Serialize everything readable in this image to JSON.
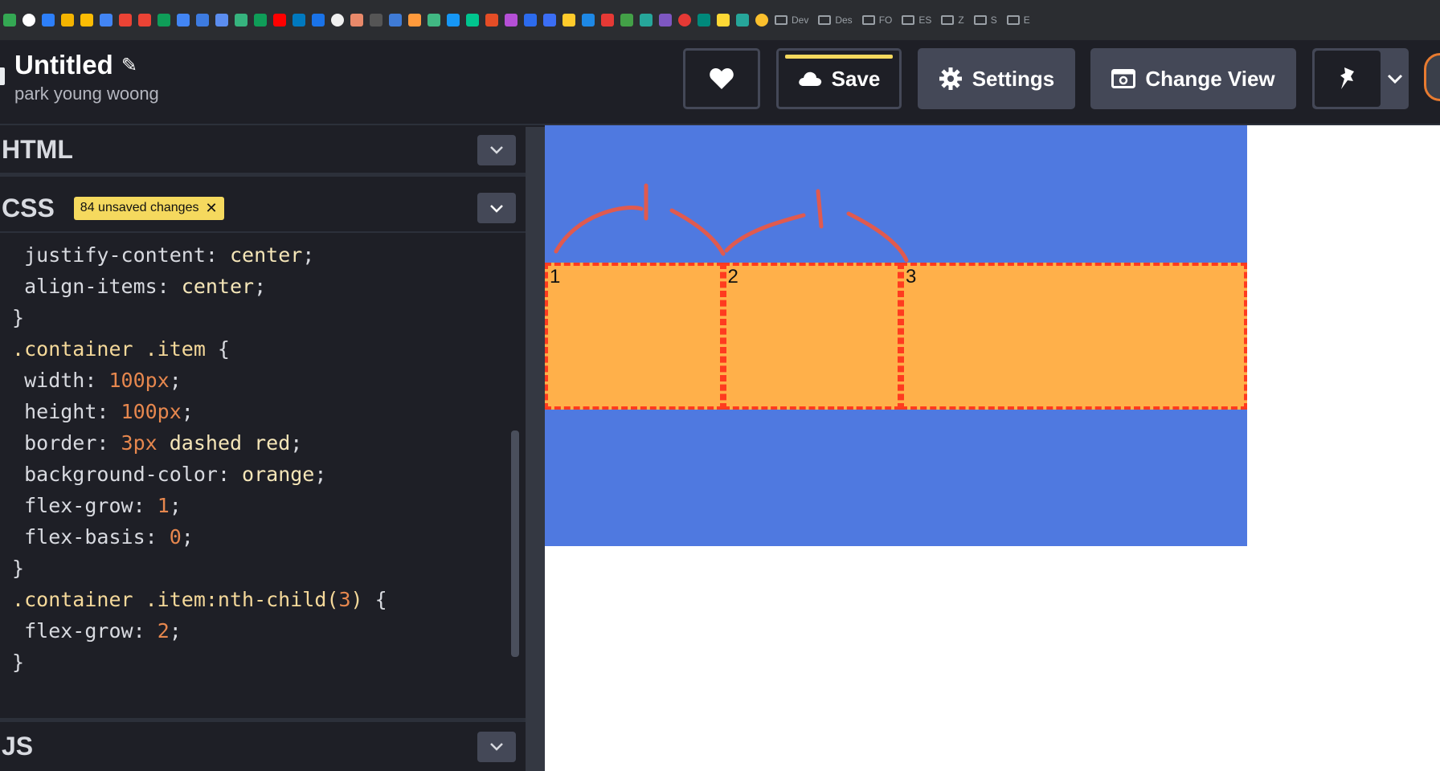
{
  "header": {
    "title": "Untitled",
    "author": "park young woong",
    "buttons": {
      "save": "Save",
      "settings": "Settings",
      "change_view": "Change View"
    }
  },
  "bookmarks": {
    "folders": [
      "Dev",
      "Des",
      "FO",
      "ES",
      "Z",
      "S",
      "E"
    ]
  },
  "editor": {
    "html_title": "HTML",
    "css_title": "CSS",
    "js_title": "JS",
    "unsaved_badge": "84 unsaved changes",
    "css_lines": [
      "  justify-content: center;",
      "  align-items: center;",
      "}",
      ".container .item {",
      "  width: 100px;",
      "  height: 100px;",
      "  border: 3px dashed red;",
      "  background-color: orange;",
      "  flex-grow: 1;",
      "  flex-basis: 0;",
      "}",
      ".container .item:nth-child(3) {",
      "  flex-grow: 2;",
      "}"
    ]
  },
  "preview": {
    "items": [
      {
        "label": "1",
        "grow": 1
      },
      {
        "label": "2",
        "grow": 1
      },
      {
        "label": "3",
        "grow": 2
      }
    ]
  },
  "colors": {
    "container_bg": "#4f79e0",
    "item_bg": "#ffb04a",
    "item_border": "#ff3b1f",
    "badge": "#f5d95e"
  }
}
